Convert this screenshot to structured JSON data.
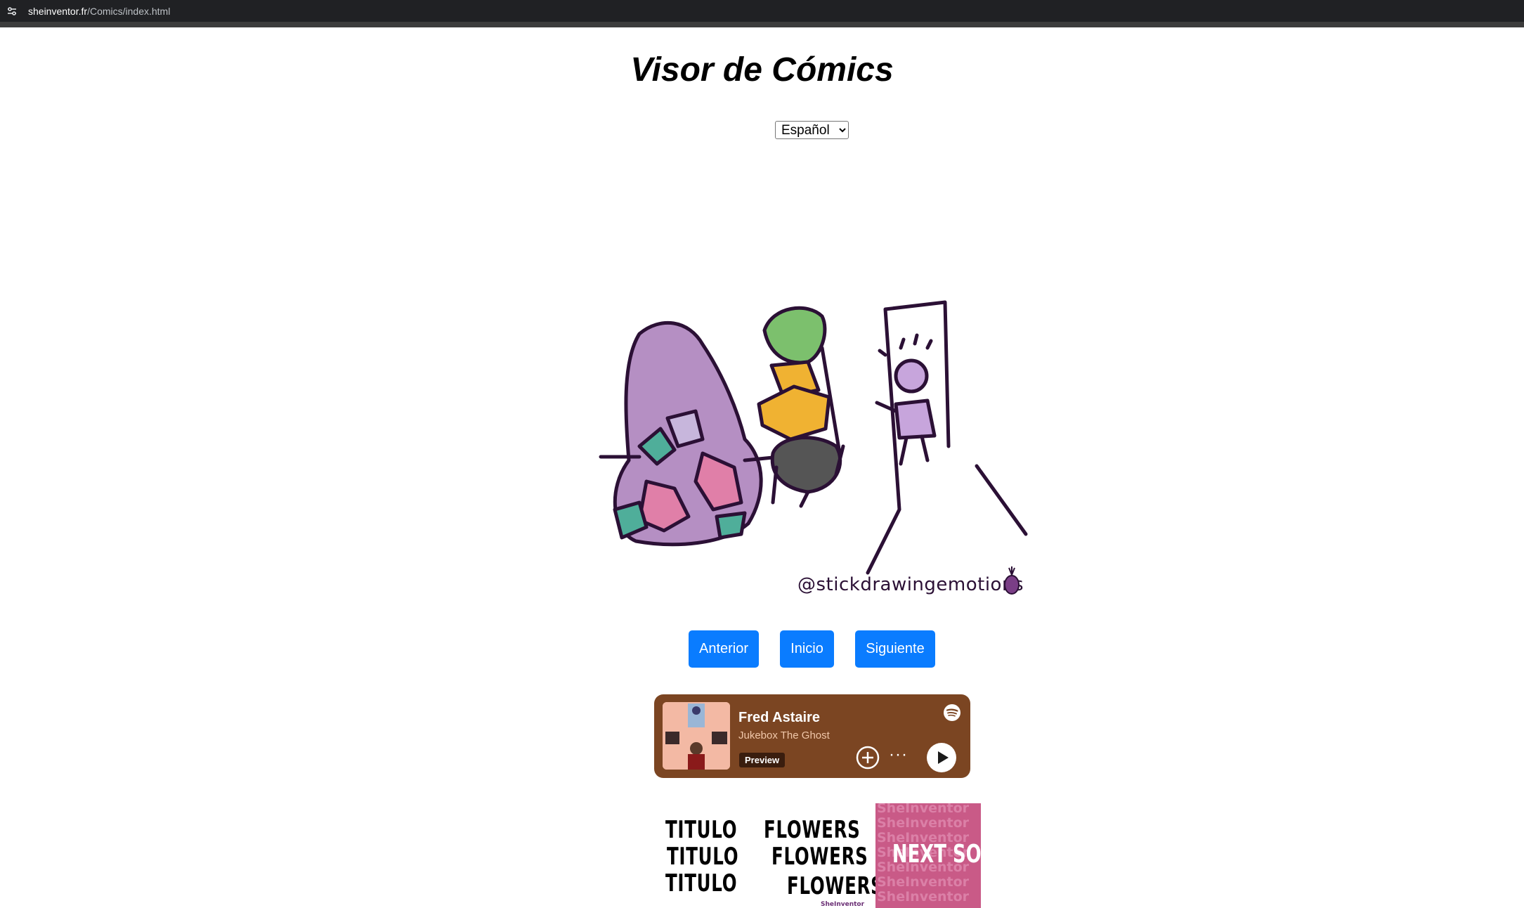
{
  "browser": {
    "url_host": "sheinventor.fr",
    "url_path": "/Comics/index.html",
    "site_info_icon": "tune-icon"
  },
  "page": {
    "title": "Visor de Cómics"
  },
  "language_select": {
    "selected": "Español"
  },
  "comic": {
    "credit": "@stickdrawingemotions",
    "credit_icon": "pineapple-icon"
  },
  "nav": {
    "prev_label": "Anterior",
    "home_label": "Inicio",
    "next_label": "Siguiente",
    "button_color": "#0a7cff"
  },
  "player": {
    "track": "Fred Astaire",
    "artist": "Jukebox The Ghost",
    "badge": "Preview",
    "more_label": "···",
    "background_color": "#7b4522",
    "icons": [
      "spotify-icon",
      "add-circle-icon",
      "more-icon",
      "play-icon"
    ]
  },
  "thumbnails": [
    {
      "words": [
        "TITULO",
        "TITULO",
        "TITULO"
      ]
    },
    {
      "words": [
        "FLOWERS",
        "FLOWERS",
        "FLOWERS"
      ],
      "logo": "SheInventor"
    },
    {
      "label": "NEXT SOON",
      "watermark": "SheInventor",
      "background_color": "#c95a87"
    }
  ]
}
